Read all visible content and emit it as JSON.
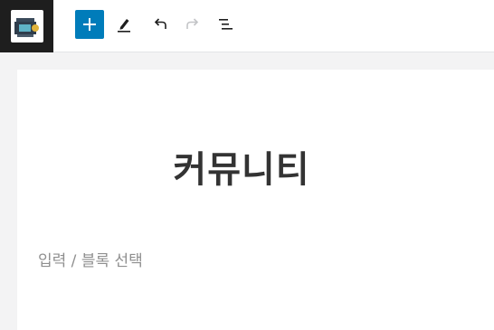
{
  "toolbar": {
    "logo_icon": "site-logo-icon",
    "inserter_icon": "plus-icon",
    "tools_icon": "pencil-icon",
    "undo_icon": "undo-icon",
    "redo_icon": "redo-icon",
    "outline_icon": "list-view-icon",
    "accent_color": "#007cba"
  },
  "editor": {
    "title": "커뮤니티",
    "block_placeholder": "입력 / 블록 선택"
  }
}
